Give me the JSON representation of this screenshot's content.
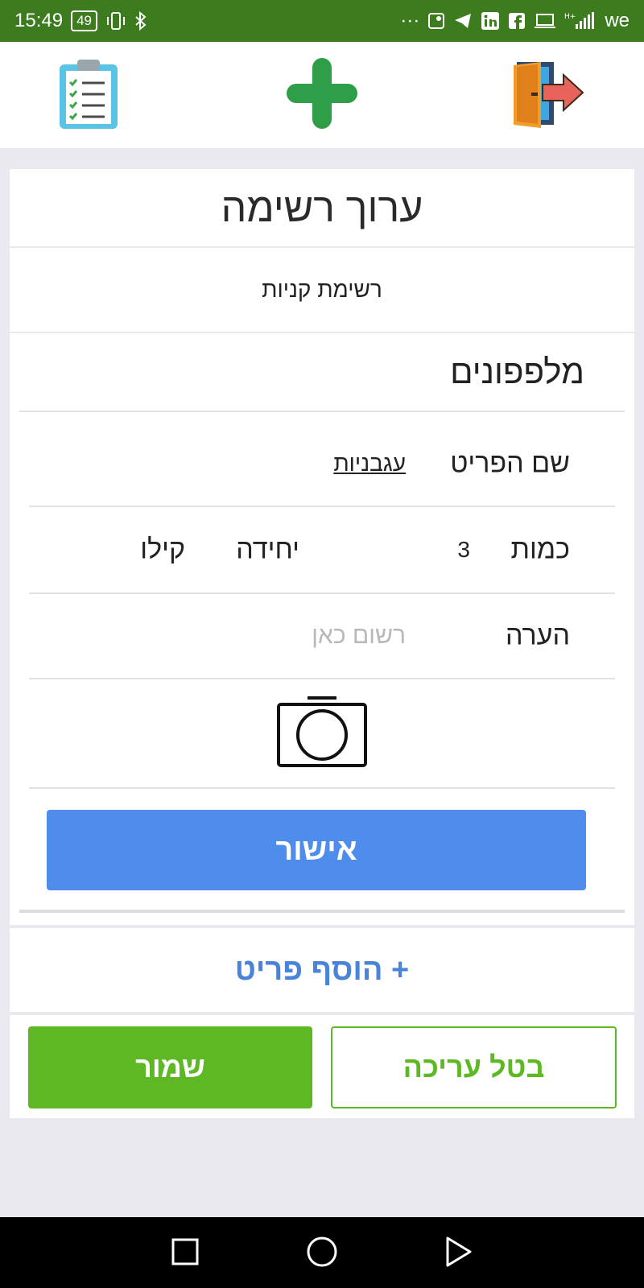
{
  "status_bar": {
    "time": "15:49",
    "battery": "49",
    "dots": "···",
    "carrier": "we"
  },
  "toolbar": {
    "lists_icon": "clipboard-checklist-icon",
    "add_icon": "plus-icon",
    "exit_icon": "exit-door-icon"
  },
  "page": {
    "title": "ערוך רשימה",
    "list_name": "רשימת קניות"
  },
  "item": {
    "category": "מלפפונים",
    "name_label": "שם הפריט",
    "name_value": "עגבניות",
    "quantity_label": "כמות",
    "quantity_value": "3",
    "unit_label": "יחידה",
    "unit_value": "קילו",
    "note_label": "הערה",
    "note_placeholder": "רשום כאן",
    "camera_icon": "camera-icon",
    "confirm_label": "אישור"
  },
  "actions": {
    "add_item_label": "+ הוסף פריט",
    "save_label": "שמור",
    "cancel_label": "בטל עריכה"
  },
  "colors": {
    "status_bar": "#3d7b1f",
    "confirm_blue": "#4f8ded",
    "link_blue": "#4a84d9",
    "save_green": "#5eb823"
  }
}
